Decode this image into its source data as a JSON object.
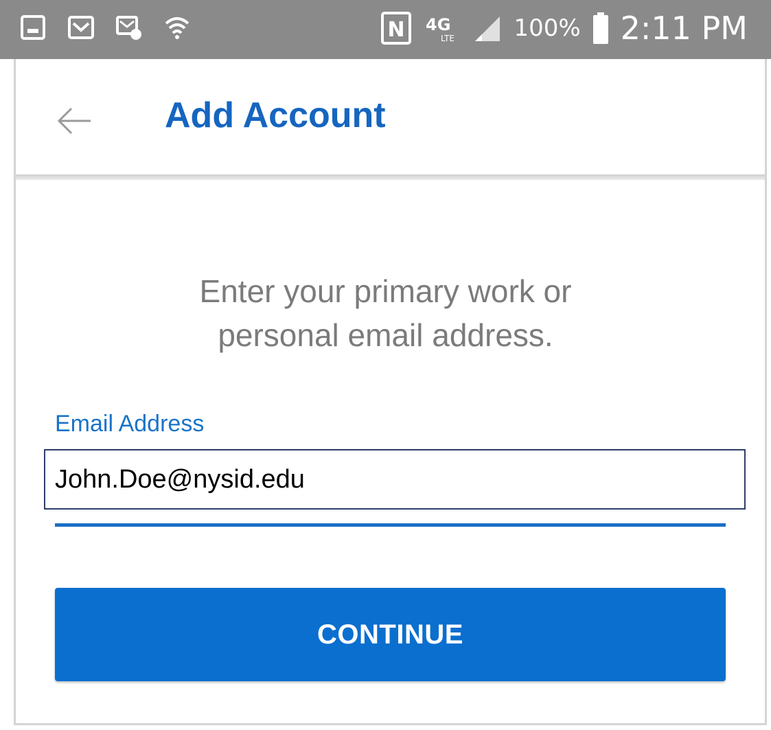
{
  "status_bar": {
    "battery": "100%",
    "time": "2:11 PM",
    "network": "4G",
    "network_sub": "LTE",
    "nfc_letter": "N",
    "left_icons": [
      "gallery-icon",
      "mail-icon",
      "mail-settings-icon",
      "wifi-icon"
    ],
    "right_icons": [
      "nfc-icon",
      "lte-icon",
      "signal-icon",
      "battery-icon"
    ]
  },
  "header": {
    "title": "Add Account",
    "back_icon": "back-arrow-icon"
  },
  "main": {
    "instruction_line1": "Enter your primary work or",
    "instruction_line2": "personal email address.",
    "email_label": "Email Address",
    "email_value": "John.Doe@nysid.edu",
    "continue_label": "CONTINUE"
  },
  "colors": {
    "status_bar": "#8a8a8a",
    "accent": "#1565c0",
    "button": "#0b6fcf",
    "instruction_text": "#7b7b7b"
  }
}
